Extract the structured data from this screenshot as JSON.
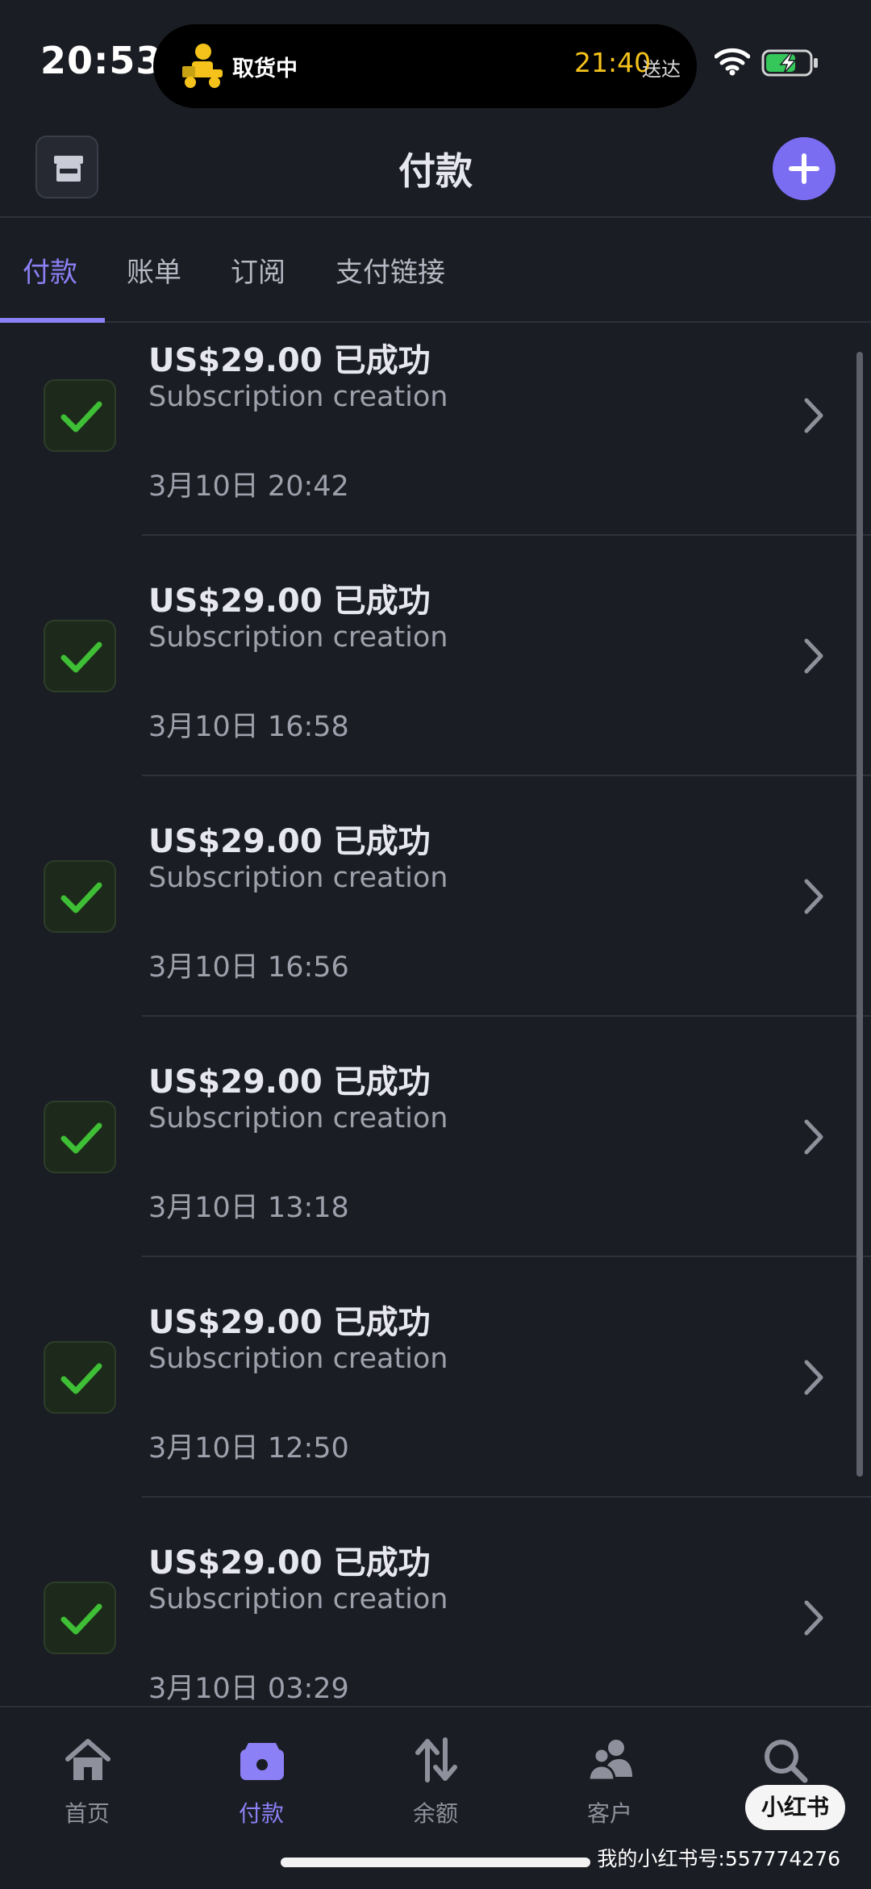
{
  "status_bar": {
    "time": "20:53",
    "island_status": "取货中",
    "eta_time": "21:40",
    "eta_label": "送达"
  },
  "header": {
    "title": "付款"
  },
  "tabs": [
    {
      "label": "付款",
      "active": true
    },
    {
      "label": "账单",
      "active": false
    },
    {
      "label": "订阅",
      "active": false
    },
    {
      "label": "支付链接",
      "active": false
    }
  ],
  "payments": [
    {
      "amount": "US$29.00 已成功",
      "description": "Subscription creation",
      "time": "3月10日 20:42"
    },
    {
      "amount": "US$29.00 已成功",
      "description": "Subscription creation",
      "time": "3月10日 16:58"
    },
    {
      "amount": "US$29.00 已成功",
      "description": "Subscription creation",
      "time": "3月10日 16:56"
    },
    {
      "amount": "US$29.00 已成功",
      "description": "Subscription creation",
      "time": "3月10日 13:18"
    },
    {
      "amount": "US$29.00 已成功",
      "description": "Subscription creation",
      "time": "3月10日 12:50"
    },
    {
      "amount": "US$29.00 已成功",
      "description": "Subscription creation",
      "time": "3月10日 03:29"
    }
  ],
  "bottom_nav": [
    {
      "label": "首页",
      "icon": "home-icon",
      "active": false
    },
    {
      "label": "付款",
      "icon": "wallet-icon",
      "active": true
    },
    {
      "label": "余额",
      "icon": "transfer-arrows-icon",
      "active": false
    },
    {
      "label": "客户",
      "icon": "customers-icon",
      "active": false
    },
    {
      "label": "",
      "icon": "search-icon",
      "active": false
    }
  ],
  "watermark": {
    "badge": "小红书",
    "id_text": "我的小红书号:557774276"
  },
  "colors": {
    "background": "#1b1d24",
    "accent": "#8b80f5",
    "success": "#3fbf35",
    "eta": "#f4c21b"
  }
}
